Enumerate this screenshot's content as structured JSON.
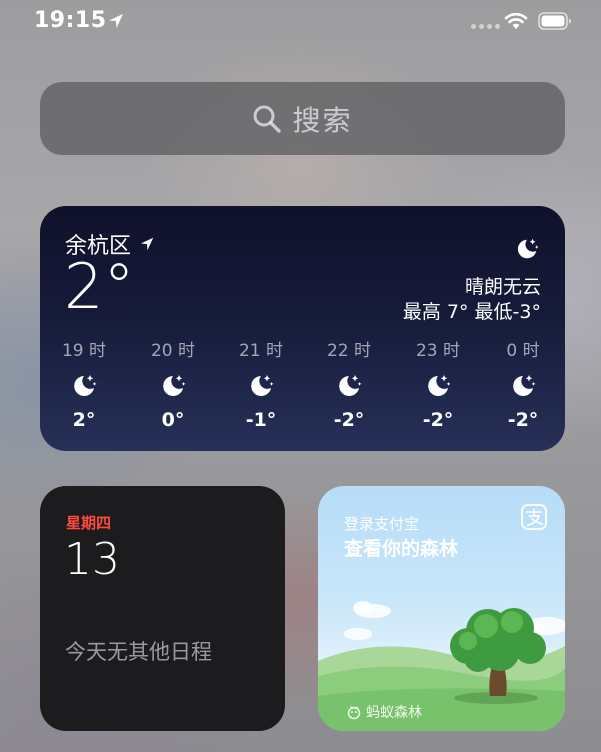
{
  "status_bar": {
    "time": "19:15",
    "icons": [
      "location-arrow-icon",
      "cellular-dots-icon",
      "wifi-icon",
      "battery-icon"
    ]
  },
  "search": {
    "label": "搜索",
    "icon": "search-icon"
  },
  "weather": {
    "location": "余杭区",
    "location_icon": "location-arrow-icon",
    "temperature": "2°",
    "condition": "晴朗无云",
    "high_low": "最高 7° 最低-3°",
    "condition_icon": "moon-stars-icon",
    "hourly": [
      {
        "time": "19 时",
        "temp": "2°",
        "icon": "moon-stars-icon"
      },
      {
        "time": "20 时",
        "temp": "0°",
        "icon": "moon-stars-icon"
      },
      {
        "time": "21 时",
        "temp": "-1°",
        "icon": "moon-stars-icon"
      },
      {
        "time": "22 时",
        "temp": "-2°",
        "icon": "moon-stars-icon"
      },
      {
        "time": "23 时",
        "temp": "-2°",
        "icon": "moon-stars-icon"
      },
      {
        "time": "0 时",
        "temp": "-2°",
        "icon": "moon-stars-icon"
      }
    ]
  },
  "calendar": {
    "weekday": "星期四",
    "day": "13",
    "no_events": "今天无其他日程"
  },
  "alipay": {
    "line1": "登录支付宝",
    "line2": "查看你的森林",
    "brand": "蚂蚁森林",
    "logo_icon": "alipay-logo-icon",
    "scene": "tree-landscape-illustration"
  },
  "colors": {
    "weather_bg": "#161b3a",
    "calendar_bg": "#1c1c1e",
    "weekday_red": "#ff4a3d",
    "alipay_sky": "#c7e6fa"
  }
}
